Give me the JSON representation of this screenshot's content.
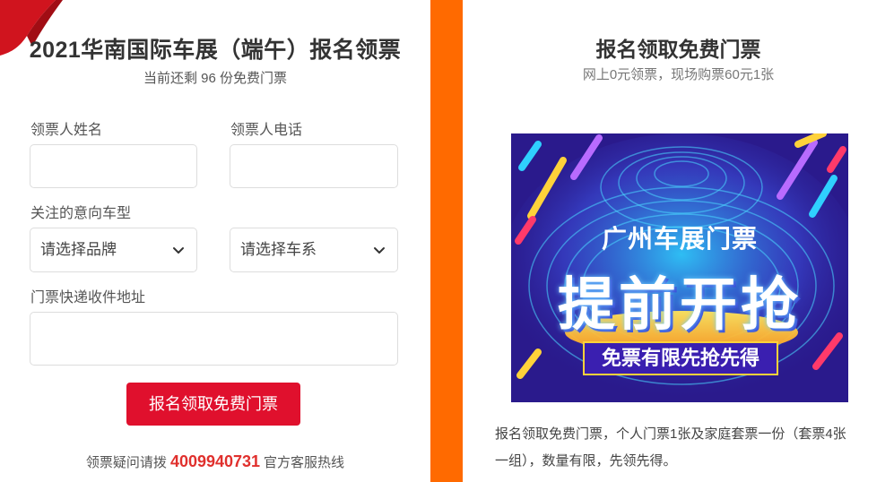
{
  "form": {
    "title": "2021华南国际车展（端午）报名领票",
    "remaining_text": "当前还剩 96 份免费门票",
    "name_label": "领票人姓名",
    "name_value": "",
    "phone_label": "领票人电话",
    "phone_value": "",
    "car_interest_label": "关注的意向车型",
    "brand_select": "请选择品牌",
    "series_select": "请选择车系",
    "address_label": "门票快递收件地址",
    "address_value": "",
    "submit_label": "报名领取免费门票",
    "hotline_prefix": "领票疑问请拨",
    "hotline_number": "4009940731",
    "hotline_suffix": "官方客服热线"
  },
  "promo": {
    "title": "报名领取免费门票",
    "subtitle": "网上0元领票，现场购票60元1张",
    "banner_line1": "广州车展门票",
    "banner_line2": "提前开抢",
    "banner_line3": "免票有限先抢先得",
    "description": "报名领取免费门票，个人门票1张及家庭套票一份（套票4张一组），数量有限，先领先得。"
  },
  "colors": {
    "accent_red": "#e0102d",
    "divider_orange": "#ff6a00",
    "banner_bg": "#2a1a8c"
  }
}
